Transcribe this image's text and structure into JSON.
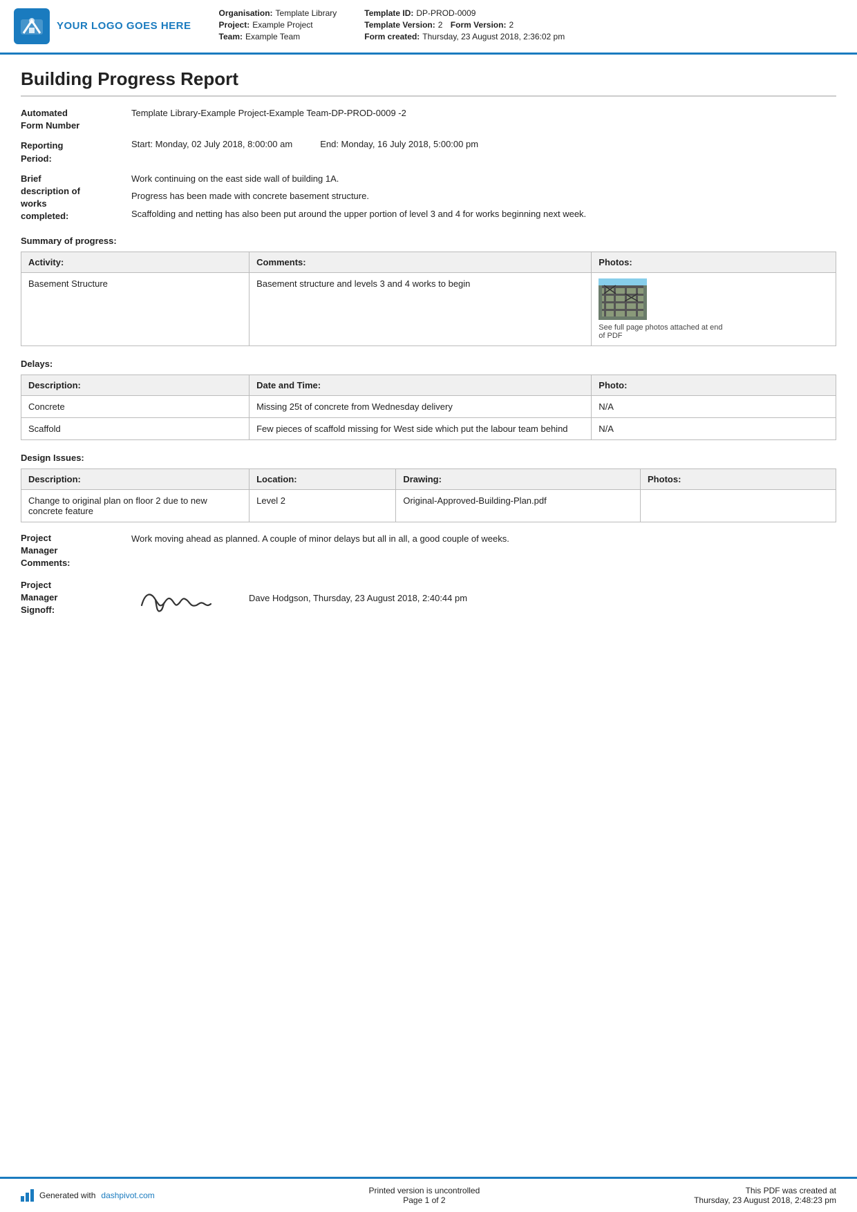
{
  "header": {
    "logo_text": "YOUR LOGO GOES HERE",
    "org_label": "Organisation:",
    "org_value": "Template Library",
    "project_label": "Project:",
    "project_value": "Example Project",
    "team_label": "Team:",
    "team_value": "Example Team",
    "template_id_label": "Template ID:",
    "template_id_value": "DP-PROD-0009",
    "template_version_label": "Template Version:",
    "template_version_value": "2",
    "form_version_label": "Form Version:",
    "form_version_value": "2",
    "form_created_label": "Form created:",
    "form_created_value": "Thursday, 23 August 2018, 2:36:02 pm"
  },
  "report": {
    "title": "Building Progress Report",
    "form_number_label": "Automated\nForm Number",
    "form_number_value": "Template Library-Example Project-Example Team-DP-PROD-0009   -2",
    "reporting_period_label": "Reporting\nPeriod:",
    "reporting_start": "Start: Monday, 02 July 2018, 8:00:00 am",
    "reporting_end": "End: Monday, 16 July 2018, 5:00:00 pm",
    "brief_desc_label": "Brief\ndescription of\nworks\ncompleted:",
    "brief_desc_lines": [
      "Work continuing on the east side wall of building 1A.",
      "Progress has been made with concrete basement structure.",
      "Scaffolding and netting has also been put around the upper portion of level 3 and 4 for works beginning next week."
    ]
  },
  "summary": {
    "section_label": "Summary of progress:",
    "table": {
      "headers": [
        "Activity:",
        "Comments:",
        "Photos:"
      ],
      "rows": [
        {
          "activity": "Basement Structure",
          "comments": "Basement structure and levels 3 and 4 works to begin",
          "photo_caption": "See full page photos attached at end of PDF"
        }
      ]
    }
  },
  "delays": {
    "section_label": "Delays:",
    "table": {
      "headers": [
        "Description:",
        "Date and Time:",
        "Photo:"
      ],
      "rows": [
        {
          "description": "Concrete",
          "date_time": "Missing 25t of concrete from Wednesday delivery",
          "photo": "N/A"
        },
        {
          "description": "Scaffold",
          "date_time": "Few pieces of scaffold missing for West side which put the labour team behind",
          "photo": "N/A"
        }
      ]
    }
  },
  "design_issues": {
    "section_label": "Design Issues:",
    "table": {
      "headers": [
        "Description:",
        "Location:",
        "Drawing:",
        "Photos:"
      ],
      "rows": [
        {
          "description": "Change to original plan on floor 2 due to new concrete feature",
          "location": "Level 2",
          "drawing": "Original-Approved-Building-Plan.pdf",
          "photos": ""
        }
      ]
    }
  },
  "project_manager": {
    "comments_label": "Project\nManager\nComments:",
    "comments_value": "Work moving ahead as planned. A couple of minor delays but all in all, a good couple of weeks.",
    "signoff_label": "Project\nManager\nSignoff:",
    "signoff_name": "Dave Hodgson, Thursday, 23 August 2018, 2:40:44 pm"
  },
  "footer": {
    "generated_text": "Generated with",
    "generated_link": "dashpivot.com",
    "center_text": "Printed version is uncontrolled",
    "page_text": "Page 1 of 2",
    "right_text": "This PDF was created at\nThursday, 23 August 2018, 2:48:23 pm"
  }
}
